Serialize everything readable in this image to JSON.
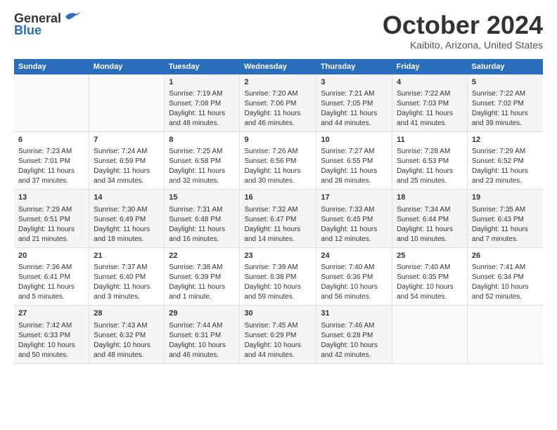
{
  "header": {
    "logo_line1": "General",
    "logo_line2": "Blue",
    "month": "October 2024",
    "location": "Kaibito, Arizona, United States"
  },
  "weekdays": [
    "Sunday",
    "Monday",
    "Tuesday",
    "Wednesday",
    "Thursday",
    "Friday",
    "Saturday"
  ],
  "weeks": [
    [
      {
        "day": "",
        "sunrise": "",
        "sunset": "",
        "daylight": ""
      },
      {
        "day": "",
        "sunrise": "",
        "sunset": "",
        "daylight": ""
      },
      {
        "day": "1",
        "sunrise": "Sunrise: 7:19 AM",
        "sunset": "Sunset: 7:08 PM",
        "daylight": "Daylight: 11 hours and 48 minutes."
      },
      {
        "day": "2",
        "sunrise": "Sunrise: 7:20 AM",
        "sunset": "Sunset: 7:06 PM",
        "daylight": "Daylight: 11 hours and 46 minutes."
      },
      {
        "day": "3",
        "sunrise": "Sunrise: 7:21 AM",
        "sunset": "Sunset: 7:05 PM",
        "daylight": "Daylight: 11 hours and 44 minutes."
      },
      {
        "day": "4",
        "sunrise": "Sunrise: 7:22 AM",
        "sunset": "Sunset: 7:03 PM",
        "daylight": "Daylight: 11 hours and 41 minutes."
      },
      {
        "day": "5",
        "sunrise": "Sunrise: 7:22 AM",
        "sunset": "Sunset: 7:02 PM",
        "daylight": "Daylight: 11 hours and 39 minutes."
      }
    ],
    [
      {
        "day": "6",
        "sunrise": "Sunrise: 7:23 AM",
        "sunset": "Sunset: 7:01 PM",
        "daylight": "Daylight: 11 hours and 37 minutes."
      },
      {
        "day": "7",
        "sunrise": "Sunrise: 7:24 AM",
        "sunset": "Sunset: 6:59 PM",
        "daylight": "Daylight: 11 hours and 34 minutes."
      },
      {
        "day": "8",
        "sunrise": "Sunrise: 7:25 AM",
        "sunset": "Sunset: 6:58 PM",
        "daylight": "Daylight: 11 hours and 32 minutes."
      },
      {
        "day": "9",
        "sunrise": "Sunrise: 7:26 AM",
        "sunset": "Sunset: 6:56 PM",
        "daylight": "Daylight: 11 hours and 30 minutes."
      },
      {
        "day": "10",
        "sunrise": "Sunrise: 7:27 AM",
        "sunset": "Sunset: 6:55 PM",
        "daylight": "Daylight: 11 hours and 28 minutes."
      },
      {
        "day": "11",
        "sunrise": "Sunrise: 7:28 AM",
        "sunset": "Sunset: 6:53 PM",
        "daylight": "Daylight: 11 hours and 25 minutes."
      },
      {
        "day": "12",
        "sunrise": "Sunrise: 7:29 AM",
        "sunset": "Sunset: 6:52 PM",
        "daylight": "Daylight: 11 hours and 23 minutes."
      }
    ],
    [
      {
        "day": "13",
        "sunrise": "Sunrise: 7:29 AM",
        "sunset": "Sunset: 6:51 PM",
        "daylight": "Daylight: 11 hours and 21 minutes."
      },
      {
        "day": "14",
        "sunrise": "Sunrise: 7:30 AM",
        "sunset": "Sunset: 6:49 PM",
        "daylight": "Daylight: 11 hours and 18 minutes."
      },
      {
        "day": "15",
        "sunrise": "Sunrise: 7:31 AM",
        "sunset": "Sunset: 6:48 PM",
        "daylight": "Daylight: 11 hours and 16 minutes."
      },
      {
        "day": "16",
        "sunrise": "Sunrise: 7:32 AM",
        "sunset": "Sunset: 6:47 PM",
        "daylight": "Daylight: 11 hours and 14 minutes."
      },
      {
        "day": "17",
        "sunrise": "Sunrise: 7:33 AM",
        "sunset": "Sunset: 6:45 PM",
        "daylight": "Daylight: 11 hours and 12 minutes."
      },
      {
        "day": "18",
        "sunrise": "Sunrise: 7:34 AM",
        "sunset": "Sunset: 6:44 PM",
        "daylight": "Daylight: 11 hours and 10 minutes."
      },
      {
        "day": "19",
        "sunrise": "Sunrise: 7:35 AM",
        "sunset": "Sunset: 6:43 PM",
        "daylight": "Daylight: 11 hours and 7 minutes."
      }
    ],
    [
      {
        "day": "20",
        "sunrise": "Sunrise: 7:36 AM",
        "sunset": "Sunset: 6:41 PM",
        "daylight": "Daylight: 11 hours and 5 minutes."
      },
      {
        "day": "21",
        "sunrise": "Sunrise: 7:37 AM",
        "sunset": "Sunset: 6:40 PM",
        "daylight": "Daylight: 11 hours and 3 minutes."
      },
      {
        "day": "22",
        "sunrise": "Sunrise: 7:38 AM",
        "sunset": "Sunset: 6:39 PM",
        "daylight": "Daylight: 11 hours and 1 minute."
      },
      {
        "day": "23",
        "sunrise": "Sunrise: 7:39 AM",
        "sunset": "Sunset: 6:38 PM",
        "daylight": "Daylight: 10 hours and 59 minutes."
      },
      {
        "day": "24",
        "sunrise": "Sunrise: 7:40 AM",
        "sunset": "Sunset: 6:36 PM",
        "daylight": "Daylight: 10 hours and 56 minutes."
      },
      {
        "day": "25",
        "sunrise": "Sunrise: 7:40 AM",
        "sunset": "Sunset: 6:35 PM",
        "daylight": "Daylight: 10 hours and 54 minutes."
      },
      {
        "day": "26",
        "sunrise": "Sunrise: 7:41 AM",
        "sunset": "Sunset: 6:34 PM",
        "daylight": "Daylight: 10 hours and 52 minutes."
      }
    ],
    [
      {
        "day": "27",
        "sunrise": "Sunrise: 7:42 AM",
        "sunset": "Sunset: 6:33 PM",
        "daylight": "Daylight: 10 hours and 50 minutes."
      },
      {
        "day": "28",
        "sunrise": "Sunrise: 7:43 AM",
        "sunset": "Sunset: 6:32 PM",
        "daylight": "Daylight: 10 hours and 48 minutes."
      },
      {
        "day": "29",
        "sunrise": "Sunrise: 7:44 AM",
        "sunset": "Sunset: 6:31 PM",
        "daylight": "Daylight: 10 hours and 46 minutes."
      },
      {
        "day": "30",
        "sunrise": "Sunrise: 7:45 AM",
        "sunset": "Sunset: 6:29 PM",
        "daylight": "Daylight: 10 hours and 44 minutes."
      },
      {
        "day": "31",
        "sunrise": "Sunrise: 7:46 AM",
        "sunset": "Sunset: 6:28 PM",
        "daylight": "Daylight: 10 hours and 42 minutes."
      },
      {
        "day": "",
        "sunrise": "",
        "sunset": "",
        "daylight": ""
      },
      {
        "day": "",
        "sunrise": "",
        "sunset": "",
        "daylight": ""
      }
    ]
  ]
}
